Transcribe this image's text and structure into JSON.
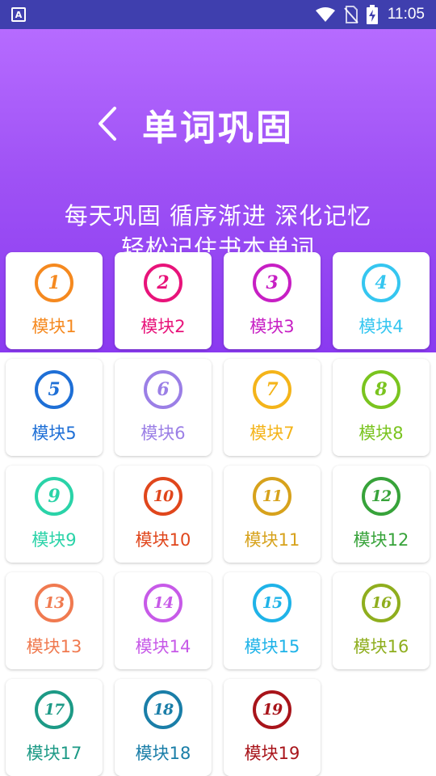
{
  "status_bar": {
    "app_icon_letter": "A",
    "time": "11:05"
  },
  "header": {
    "title": "单词巩固",
    "subtitle": "每天巩固 循序渐进 深化记忆",
    "subtitle_line2": "轻松记住书本单词"
  },
  "modules": [
    {
      "number": "1",
      "label": "模块1",
      "color": "#f5891f"
    },
    {
      "number": "2",
      "label": "模块2",
      "color": "#e8137a"
    },
    {
      "number": "3",
      "label": "模块3",
      "color": "#c71fc4"
    },
    {
      "number": "4",
      "label": "模块4",
      "color": "#35c6f0"
    },
    {
      "number": "5",
      "label": "模块5",
      "color": "#1e6fd6"
    },
    {
      "number": "6",
      "label": "模块6",
      "color": "#9b7fe6"
    },
    {
      "number": "7",
      "label": "模块7",
      "color": "#f4b41a"
    },
    {
      "number": "8",
      "label": "模块8",
      "color": "#7ac41f"
    },
    {
      "number": "9",
      "label": "模块9",
      "color": "#2ad3a8"
    },
    {
      "number": "10",
      "label": "模块10",
      "color": "#e0461c"
    },
    {
      "number": "11",
      "label": "模块11",
      "color": "#d7a21c"
    },
    {
      "number": "12",
      "label": "模块12",
      "color": "#37a33a"
    },
    {
      "number": "13",
      "label": "模块13",
      "color": "#f07a50"
    },
    {
      "number": "14",
      "label": "模块14",
      "color": "#c75ae8"
    },
    {
      "number": "15",
      "label": "模块15",
      "color": "#1fb3e8"
    },
    {
      "number": "16",
      "label": "模块16",
      "color": "#8fae1e"
    },
    {
      "number": "17",
      "label": "模块17",
      "color": "#1d9a86"
    },
    {
      "number": "18",
      "label": "模块18",
      "color": "#1a7ea8"
    },
    {
      "number": "19",
      "label": "模块19",
      "color": "#a8141a"
    }
  ]
}
